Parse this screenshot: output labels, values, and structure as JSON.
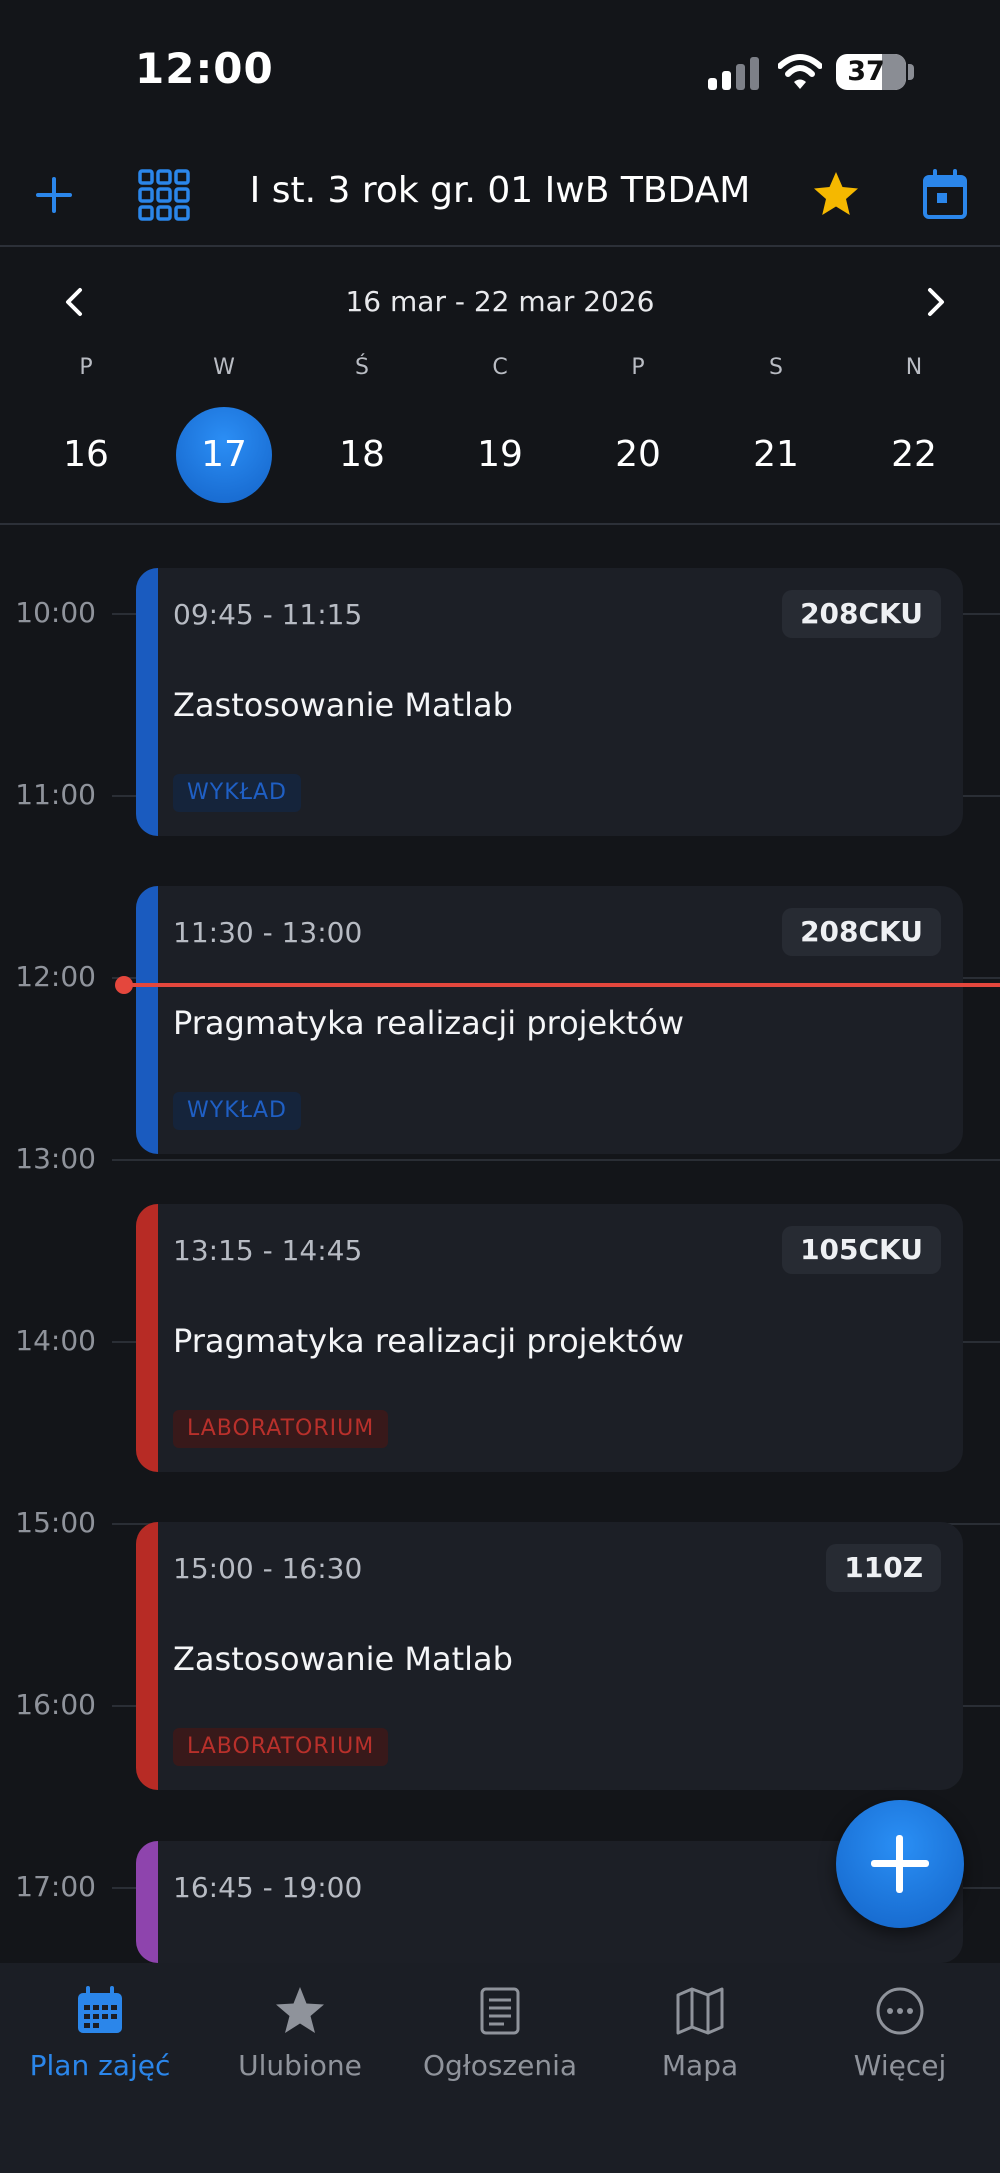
{
  "status_bar": {
    "time": "12:00",
    "battery": "37"
  },
  "header": {
    "title": "I st. 3 rok gr. 01 IwB TBDAM",
    "add_icon": "plus-icon",
    "grid_icon": "grid-icon",
    "favorite_icon": "star-icon",
    "calendar_icon": "calendar-icon"
  },
  "week": {
    "range": "16 mar - 22 mar 2026",
    "days": [
      {
        "letter": "P",
        "num": "16",
        "selected": false
      },
      {
        "letter": "W",
        "num": "17",
        "selected": true
      },
      {
        "letter": "Ś",
        "num": "18",
        "selected": false
      },
      {
        "letter": "C",
        "num": "19",
        "selected": false
      },
      {
        "letter": "P",
        "num": "20",
        "selected": false
      },
      {
        "letter": "S",
        "num": "21",
        "selected": false
      },
      {
        "letter": "N",
        "num": "22",
        "selected": false
      }
    ]
  },
  "timeline": {
    "hours": [
      "10:00",
      "11:00",
      "12:00",
      "13:00",
      "14:00",
      "15:00",
      "16:00",
      "17:00"
    ],
    "current_time": "12:00"
  },
  "events": [
    {
      "time": "09:45 - 11:15",
      "room": "208CKU",
      "title": "Zastosowanie Matlab",
      "type": "WYKŁAD",
      "color": "#1a5bbf"
    },
    {
      "time": "11:30 - 13:00",
      "room": "208CKU",
      "title": "Pragmatyka realizacji projektów",
      "type": "WYKŁAD",
      "color": "#1a5bbf"
    },
    {
      "time": "13:15 - 14:45",
      "room": "105CKU",
      "title": "Pragmatyka realizacji projektów",
      "type": "LABORATORIUM",
      "color": "#b72b25"
    },
    {
      "time": "15:00 - 16:30",
      "room": "110Z",
      "title": "Zastosowanie Matlab",
      "type": "LABORATORIUM",
      "color": "#b72b25"
    },
    {
      "time": "16:45 - 19:00",
      "color": "#8e44ad"
    }
  ],
  "bottom_nav": [
    {
      "label": "Plan zajęć",
      "icon": "calendar-icon",
      "active": true
    },
    {
      "label": "Ulubione",
      "icon": "star-icon",
      "active": false
    },
    {
      "label": "Ogłoszenia",
      "icon": "news-icon",
      "active": false
    },
    {
      "label": "Mapa",
      "icon": "map-icon",
      "active": false
    },
    {
      "label": "Więcej",
      "icon": "more-icon",
      "active": false
    }
  ],
  "colors": {
    "accent": "#2b86ea",
    "favorite": "#f5b800",
    "now_line": "#e4473d"
  }
}
